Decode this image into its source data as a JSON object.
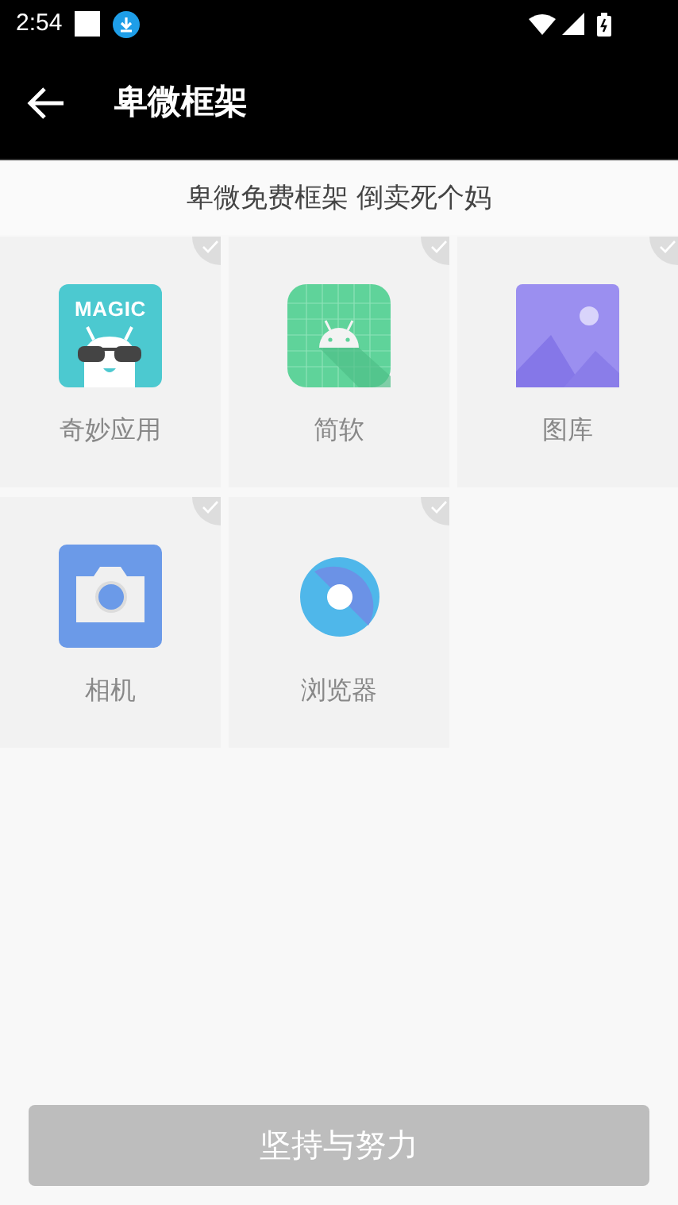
{
  "status_bar": {
    "time": "2:54"
  },
  "app_bar": {
    "title": "卑微框架"
  },
  "subtitle": "卑微免费框架 倒卖死个妈",
  "apps": [
    {
      "kind": "magic",
      "icon_text": "MAGIC",
      "label": "奇妙应用",
      "checked": false
    },
    {
      "kind": "android",
      "label": "简软",
      "checked": false
    },
    {
      "kind": "gallery",
      "label": "图库",
      "checked": false
    },
    {
      "kind": "camera",
      "label": "相机",
      "checked": false
    },
    {
      "kind": "browser",
      "label": "浏览器",
      "checked": false
    }
  ],
  "button": {
    "label": "坚持与努力",
    "disabled": true
  }
}
